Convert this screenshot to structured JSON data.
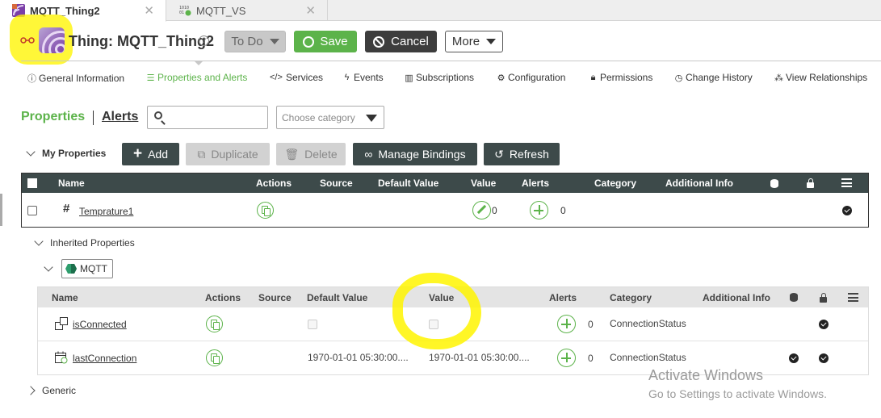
{
  "tabs": [
    {
      "label": "MQTT_Thing2",
      "active": true
    },
    {
      "label": "MQTT_VS",
      "active": false
    }
  ],
  "header": {
    "title": "Thing: MQTT_Thing2",
    "state_label": "To Do",
    "save_label": "Save",
    "cancel_label": "Cancel",
    "more_label": "More"
  },
  "nav": [
    {
      "label": "General Information",
      "icon": "info-icon"
    },
    {
      "label": "Properties and Alerts",
      "icon": "list-icon",
      "active": true
    },
    {
      "label": "Services",
      "icon": "code-icon"
    },
    {
      "label": "Events",
      "icon": "bolt-icon"
    },
    {
      "label": "Subscriptions",
      "icon": "subscriptions-icon"
    },
    {
      "label": "Configuration",
      "icon": "gear-icon"
    },
    {
      "label": "Permissions",
      "icon": "lock-icon"
    },
    {
      "label": "Change History",
      "icon": "clock-icon"
    },
    {
      "label": "View Relationships",
      "icon": "relationships-icon"
    }
  ],
  "section": {
    "properties_tab": "Properties",
    "alerts_tab": "Alerts",
    "search_value": "",
    "category_placeholder": "Choose category"
  },
  "my_properties": {
    "label": "My Properties",
    "buttons": {
      "add": "Add",
      "duplicate": "Duplicate",
      "delete": "Delete",
      "manage_bindings": "Manage Bindings",
      "refresh": "Refresh"
    },
    "columns": [
      "Name",
      "Actions",
      "Source",
      "Default Value",
      "Value",
      "Alerts",
      "Category",
      "Additional Info"
    ],
    "rows": [
      {
        "name": "Temprature1",
        "value": "0",
        "alerts": "0",
        "persistent": true
      }
    ]
  },
  "inherited": {
    "label": "Inherited Properties",
    "template": "MQTT",
    "columns": [
      "Name",
      "Actions",
      "Source",
      "Default Value",
      "Value",
      "Alerts",
      "Category",
      "Additional Info"
    ],
    "rows": [
      {
        "name": "isConnected",
        "default_value": "",
        "value": "",
        "alerts": "0",
        "category": "ConnectionStatus"
      },
      {
        "name": "lastConnection",
        "default_value": "1970-01-01 05:30:00....",
        "value": "1970-01-01 05:30:00....",
        "alerts": "0",
        "category": "ConnectionStatus"
      }
    ]
  },
  "generic_label": "Generic",
  "watermark": {
    "line1": "Activate Windows",
    "line2": "Go to Settings to activate Windows."
  },
  "colors": {
    "accent_green": "#5cb34a",
    "toolbar_dark": "#3d4a4a",
    "highlight": "#fff500"
  }
}
